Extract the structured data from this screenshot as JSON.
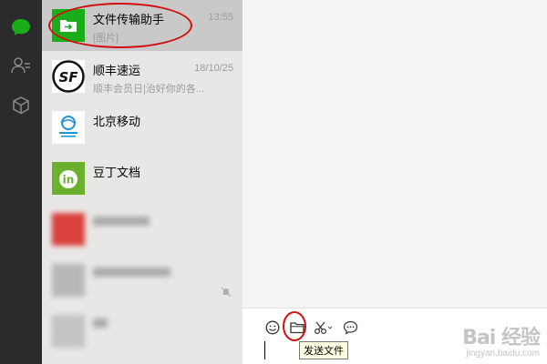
{
  "sidebar_icons": [
    {
      "icon": "chat-bubble-icon",
      "active": true
    },
    {
      "icon": "contacts-icon",
      "active": false
    },
    {
      "icon": "favorites-cube-icon",
      "active": false
    }
  ],
  "chats": [
    {
      "name": "文件传输助手",
      "preview": "[图片]",
      "time": "13:55",
      "avatar_icon": "file-transfer-icon",
      "active": true
    },
    {
      "name": "顺丰速运",
      "preview": "顺丰会员日|治好你的各...",
      "time": "18/10/25",
      "avatar_icon": "sf-express-logo"
    },
    {
      "name": "北京移动",
      "preview": "",
      "time": "",
      "avatar_icon": "china-mobile-logo"
    },
    {
      "name": "豆丁文档",
      "preview": "",
      "time": "",
      "avatar_icon": "docin-logo"
    },
    {
      "name": "",
      "preview": "",
      "time": "",
      "avatar_icon": "blurred-avatar",
      "blurred": true
    },
    {
      "name": "",
      "preview": "",
      "time": "",
      "avatar_icon": "blurred-avatar",
      "blurred": true,
      "muted_icon": "mute-bell-icon"
    },
    {
      "name": "",
      "preview": "",
      "time": "",
      "avatar_icon": "blurred-avatar",
      "blurred": true
    }
  ],
  "toolbar": {
    "tools": [
      "emoji-icon",
      "folder-icon",
      "scissors-icon",
      "chat-history-icon"
    ],
    "tooltip": "发送文件"
  },
  "watermark": {
    "main": "Bai 经验",
    "sub": "jingyan.baidu.com"
  },
  "colors": {
    "accent_green": "#1aad19",
    "annotation_red": "#d01010",
    "sidebar_bg": "#2b2b2d",
    "list_bg": "#e8e7e6",
    "active_item_bg": "#c9c9c9"
  }
}
